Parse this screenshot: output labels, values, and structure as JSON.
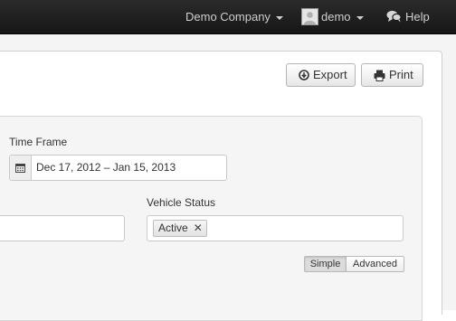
{
  "navbar": {
    "company": "Demo Company",
    "user": "demo",
    "help": "Help",
    "icons": [
      "caret-down-icon",
      "avatar-icon",
      "chat-bubbles-icon"
    ]
  },
  "toolbar": {
    "export_label": "Export",
    "print_label": "Print",
    "export_icon": "export-icon",
    "print_icon": "printer-icon"
  },
  "filters": {
    "time_frame_label": "Time Frame",
    "date_range": "Dec 17, 2012 – Jan 15, 2013",
    "date_icon": "calendar-icon",
    "text_field_value": "",
    "vehicle_status_label": "Vehicle Status",
    "vehicle_status_tags": [
      "Active"
    ],
    "mode_options": [
      "Simple",
      "Advanced"
    ],
    "mode_selected": "Simple"
  }
}
